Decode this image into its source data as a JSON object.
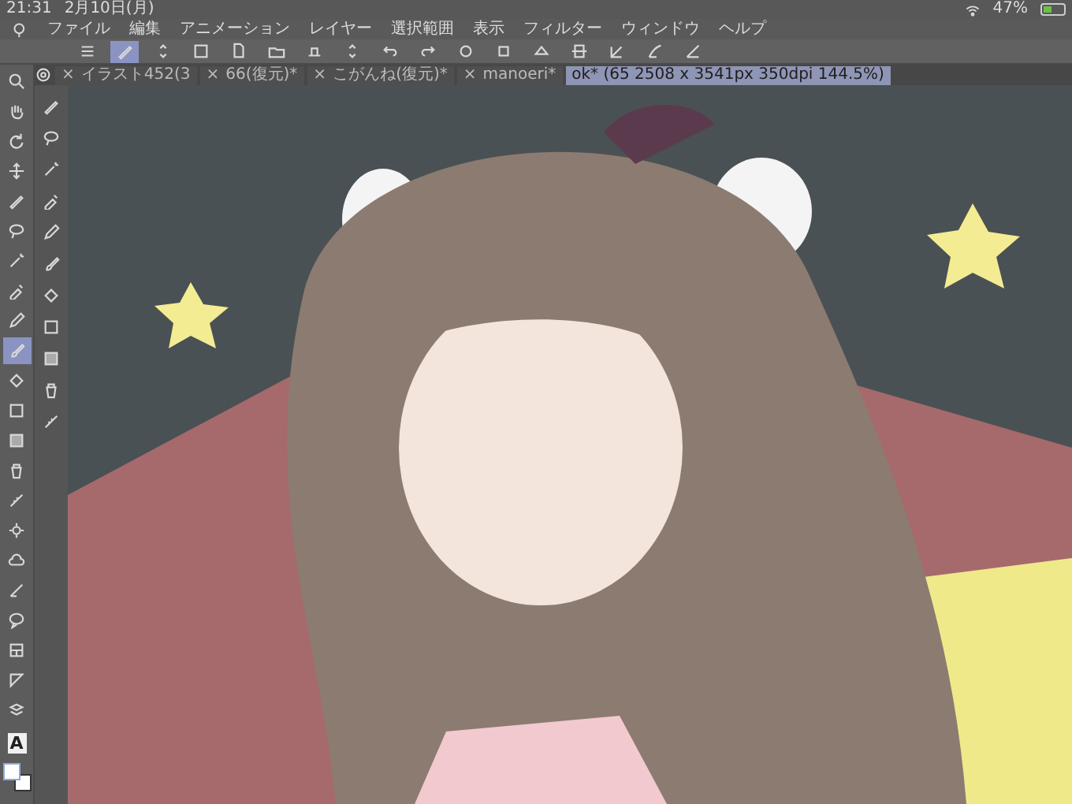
{
  "status_bar": {
    "time": "21:31",
    "date": "2月10日(月)",
    "battery": "47%"
  },
  "menu": [
    "ファイル",
    "編集",
    "アニメーション",
    "レイヤー",
    "選択範囲",
    "表示",
    "フィルター",
    "ウィンドウ",
    "ヘルプ"
  ],
  "command_bar": {
    "buttons": [
      {
        "selected": false
      },
      {
        "selected": true
      },
      {
        "selected": false
      },
      {
        "selected": false
      },
      {
        "selected": false
      },
      {
        "selected": false
      },
      {
        "selected": false
      },
      {
        "selected": false
      },
      {
        "selected": false
      },
      {
        "selected": false
      },
      {
        "selected": false
      },
      {
        "selected": false
      },
      {
        "selected": false
      },
      {
        "selected": false
      },
      {
        "selected": false
      },
      {
        "selected": false
      },
      {
        "selected": false
      }
    ]
  },
  "tabs": [
    {
      "close": "×",
      "label": "イラスト452(3",
      "selected": false
    },
    {
      "close": "×",
      "label": "66(復元)*",
      "selected": false
    },
    {
      "close": "×",
      "label": "こがんね(復元)*",
      "selected": false
    },
    {
      "close": "×",
      "label": "manoeri*",
      "selected": false
    },
    {
      "label": "ok* (65 2508 x 3541px 350dpi 144.5%)",
      "selected": true
    }
  ],
  "tools": [
    {
      "selected": false
    },
    {
      "selected": false
    },
    {
      "selected": false
    },
    {
      "selected": false
    },
    {
      "selected": false
    },
    {
      "selected": false
    },
    {
      "selected": false
    },
    {
      "selected": false
    },
    {
      "selected": false
    },
    {
      "selected": true
    },
    {
      "selected": false
    },
    {
      "selected": false
    },
    {
      "selected": false
    },
    {
      "selected": false
    },
    {
      "selected": false
    },
    {
      "selected": false
    },
    {
      "selected": false
    },
    {
      "selected": false
    },
    {
      "selected": false
    },
    {
      "selected": false
    },
    {
      "selected": false
    },
    {
      "selected": false
    }
  ],
  "text_glyph": "A",
  "subtools": [
    {
      "selected": false
    },
    {
      "selected": false
    },
    {
      "selected": false
    },
    {
      "selected": false
    },
    {
      "selected": false
    },
    {
      "selected": false
    },
    {
      "selected": false
    },
    {
      "selected": false
    },
    {
      "selected": false
    },
    {
      "selected": false
    },
    {
      "selected": false
    }
  ]
}
